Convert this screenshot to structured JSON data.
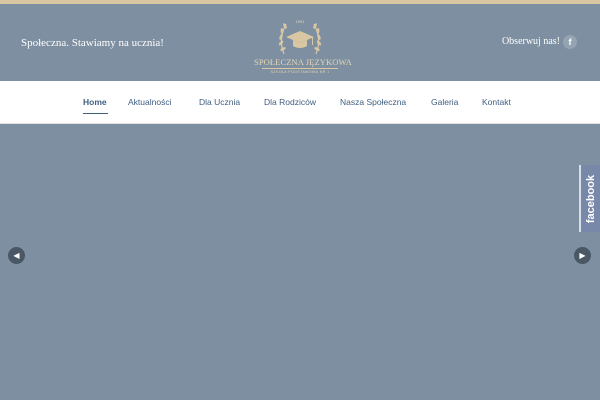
{
  "header": {
    "tagline": "Społeczna. Stawiamy na ucznia!",
    "follow_label": "Obserwuj nas!",
    "follow_icon": "f"
  },
  "logo": {
    "year": "1991",
    "title": "SPOŁECZNA JĘZYKOWA",
    "subtitle": "SZKOŁA PODSTAWOWA NR 1",
    "color": "#e4d7b6"
  },
  "nav": {
    "items": [
      {
        "label": "Home",
        "active": true
      },
      {
        "label": "Aktualności"
      },
      {
        "label": "Dla Ucznia"
      },
      {
        "label": "Dla Rodziców"
      },
      {
        "label": "Nasza Społeczna"
      },
      {
        "label": "Galeria"
      },
      {
        "label": "Kontakt"
      }
    ]
  },
  "slider": {
    "prev_icon": "◀",
    "next_icon": "▶"
  },
  "facebook_tab": {
    "label": "facebook"
  },
  "colors": {
    "header_bg": "#7d8fa1",
    "accent": "#3f5e80",
    "gold": "#d8c7a2"
  }
}
